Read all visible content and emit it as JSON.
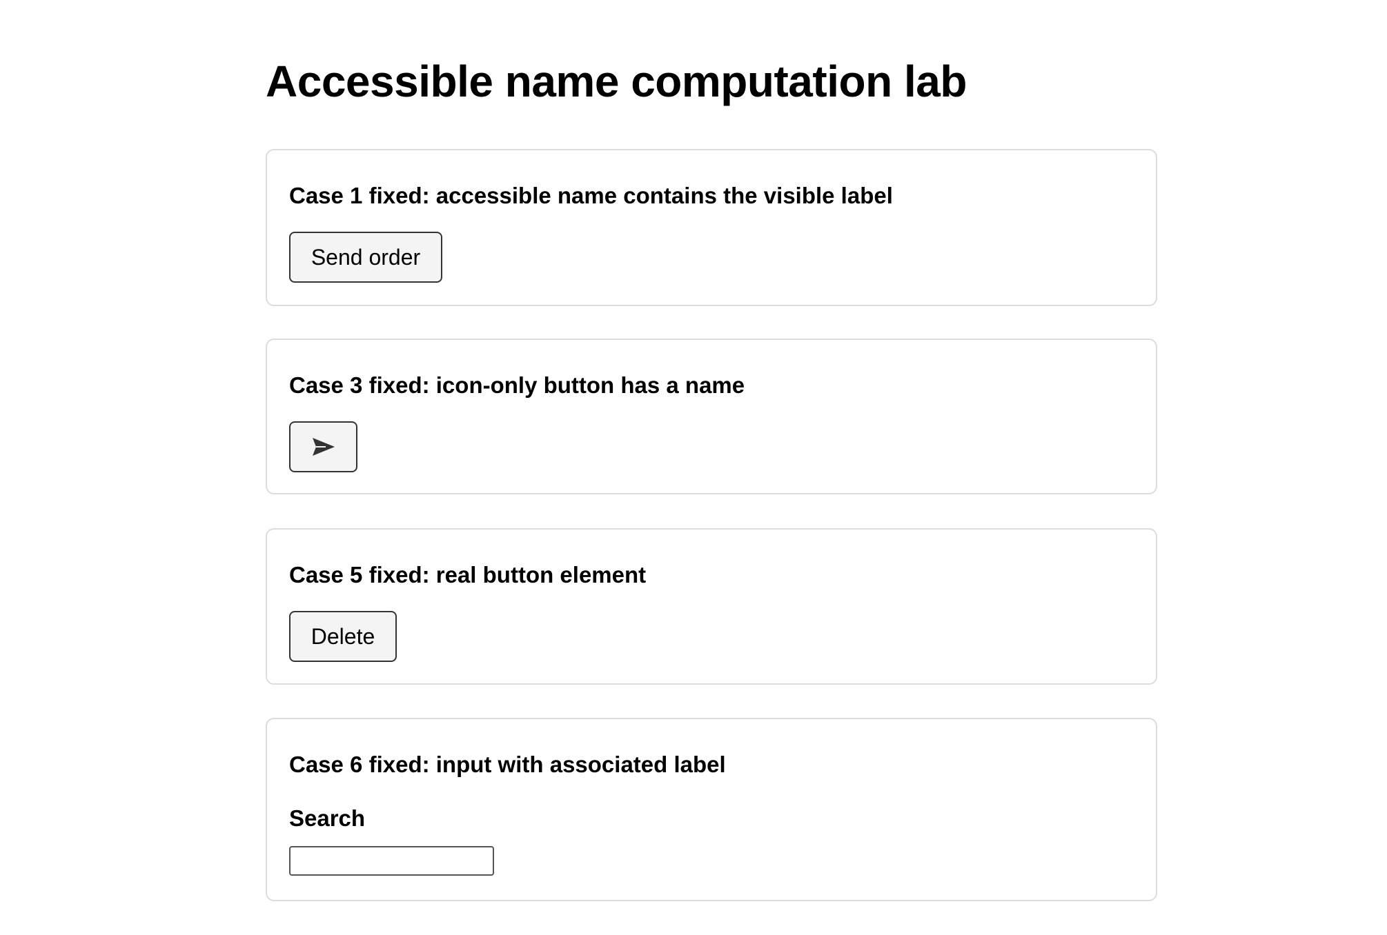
{
  "page": {
    "title": "Accessible name computation lab"
  },
  "cases": {
    "case1": {
      "heading": "Case 1 fixed: accessible name contains the visible label",
      "button_label": "Send order"
    },
    "case3": {
      "heading": "Case 3 fixed: icon-only button has a name",
      "button_icon": "send-icon"
    },
    "case5": {
      "heading": "Case 5 fixed: real button element",
      "button_label": "Delete"
    },
    "case6": {
      "heading": "Case 6 fixed: input with associated label",
      "field_label": "Search",
      "field_value": ""
    }
  }
}
